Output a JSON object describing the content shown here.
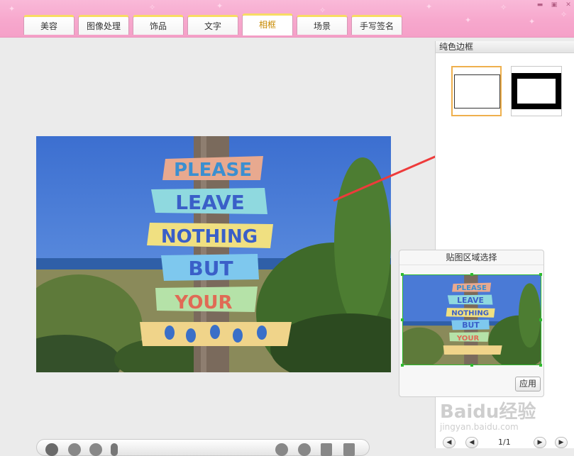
{
  "tabs": [
    {
      "label": "美容"
    },
    {
      "label": "图像处理"
    },
    {
      "label": "饰品"
    },
    {
      "label": "文字"
    },
    {
      "label": "相框",
      "active": true
    },
    {
      "label": "场景"
    },
    {
      "label": "手写签名"
    }
  ],
  "window_controls": [
    "minimize-icon",
    "restore-icon",
    "close-icon"
  ],
  "photo": {
    "sign_words": [
      "PLEASE",
      "LEAVE",
      "NOTHING",
      "BUT",
      "YOUR"
    ],
    "sign_colors": [
      "#e8a98f",
      "#8fd9df",
      "#f0e081",
      "#7ec8ee",
      "#b5e2a8",
      "#f0d48a"
    ]
  },
  "right_panel": {
    "title": "纯色边框",
    "thumbnails": [
      "thin-border",
      "thick-border"
    ],
    "selected_thumbnail": "thin-border",
    "pager": {
      "page": "1/1"
    }
  },
  "paste_panel": {
    "title": "贴图区域选择",
    "apply_label": "应用"
  },
  "watermark": {
    "brand": "Baidu经验",
    "url": "jingyan.baidu.com"
  },
  "colors": {
    "accent_pink": "#f7a8cd",
    "tab_highlight": "#f7dc63",
    "selection_green": "#2fbb2f",
    "arrow_red": "#ee3b3b",
    "selected_border": "#efb04d"
  }
}
